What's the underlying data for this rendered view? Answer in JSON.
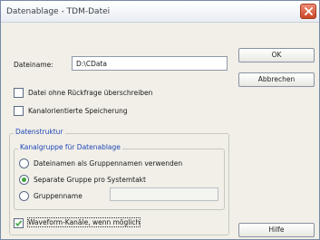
{
  "window": {
    "title": "Datenablage - TDM-Datei"
  },
  "form": {
    "dateiname_label": "Dateiname:",
    "dateiname_value": "D:\\CData",
    "overwrite_label": "Datei ohne Rückfrage überschreiben",
    "overwrite_checked": false,
    "channel_storage_label": "Kanalorientierte Speicherung",
    "channel_storage_checked": false,
    "structure_group_label": "Datenstruktur",
    "channel_group_label": "Kanalgruppe für Datenablage",
    "radio_options": [
      {
        "label": "Dateinamen als Gruppennamen verwenden",
        "selected": false
      },
      {
        "label": "Separate Gruppe pro Systemtakt",
        "selected": true
      },
      {
        "label": "Gruppenname",
        "selected": false
      }
    ],
    "gruppenname_value": "",
    "waveform_label": "Waveform-Kanäle, wenn möglich",
    "waveform_checked": true
  },
  "buttons": {
    "ok": "OK",
    "cancel": "Abbrechen",
    "help": "Hilfe"
  },
  "colors": {
    "group_title": "#1f46b8",
    "close_button": "#c84726",
    "radio_selected": "#3da53a",
    "checkmark": "#3da53a"
  }
}
